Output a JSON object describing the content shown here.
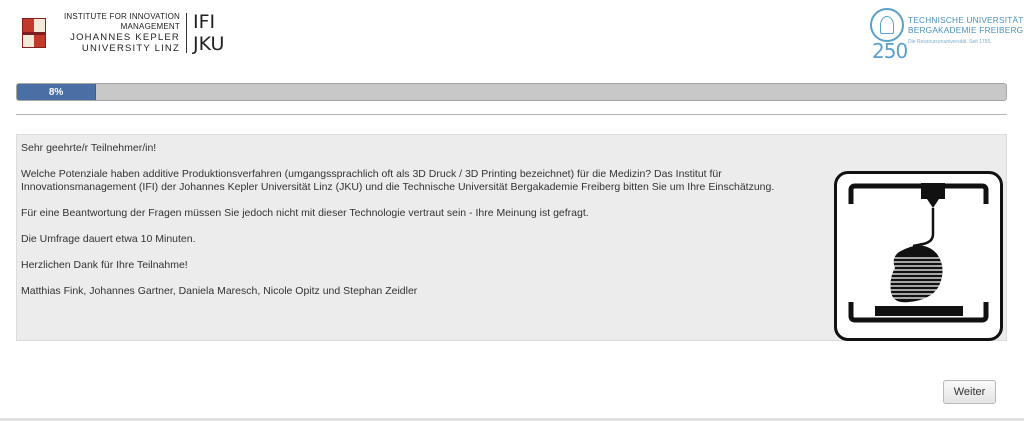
{
  "header": {
    "left_logo": {
      "institute_line1": "INSTITUTE FOR INNOVATION",
      "institute_line2": "MANAGEMENT",
      "university_line1": "JOHANNES KEPLER",
      "university_line2": "UNIVERSITY LINZ",
      "acronym1": "IFI",
      "acronym2": "JKU"
    },
    "right_logo": {
      "name_line1": "TECHNISCHE UNIVERSITÄT",
      "name_line2": "BERGAKADEMIE FREIBERG",
      "tagline": "Die Ressourcenuniversität. Seit 1765.",
      "number": "250"
    }
  },
  "progress": {
    "percent": 8,
    "label": "8%"
  },
  "intro": {
    "greeting": "Sehr geehrte/r Teilnehmer/in!",
    "paragraph1": "Welche Potenziale haben additive Produktionsverfahren (umgangssprachlich oft als 3D Druck / 3D Printing bezeichnet) für die Medizin? Das Institut für Innovationsmanagement (IFI) der Johannes Kepler Universität Linz (JKU) und die Technische Universität Bergakademie Freiberg bitten Sie um Ihre Einschätzung.",
    "paragraph2": "Für eine Beantwortung der Fragen müssen Sie jedoch nicht mit dieser Technologie vertraut sein - Ihre Meinung ist gefragt.",
    "paragraph3": "Die Umfrage dauert etwa 10 Minuten.",
    "paragraph4": "Herzlichen Dank für Ihre Teilnahme!",
    "authors": "Matthias Fink, Johannes Gartner, Daniela Maresch, Nicole Opitz und Stephan Zeidler",
    "image_icon": "3d-printer-icon"
  },
  "footer": {
    "next_label": "Weiter"
  },
  "colors": {
    "progress_fill": "#4a6fa5",
    "progress_track": "#c8c8c8",
    "panel_bg": "#ececec",
    "tu_blue": "#4a90c0"
  }
}
